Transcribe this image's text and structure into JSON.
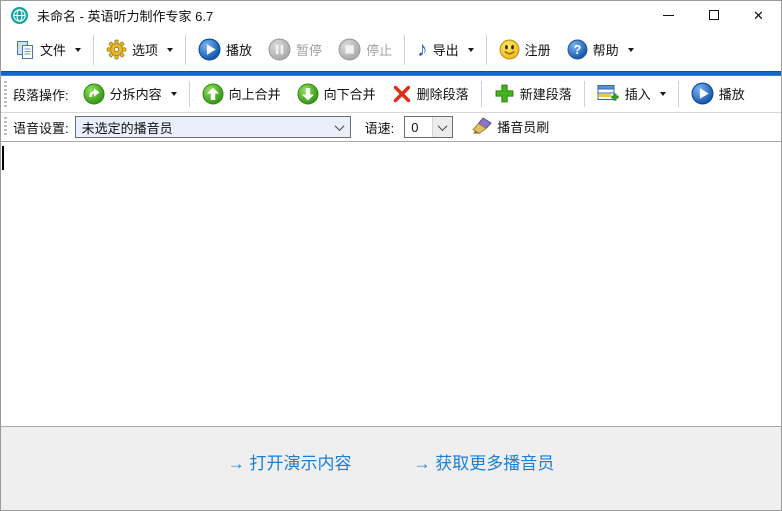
{
  "window": {
    "title": "未命名 - 英语听力制作专家 6.7",
    "controls": {
      "close_glyph": "✕"
    }
  },
  "icons": {
    "app": "teal-globe",
    "file": "copy-pages",
    "options": "gold-gear",
    "play": "blue-play-circle",
    "pause": "gray-pause-circle",
    "stop": "gray-stop-circle",
    "export": "music-note",
    "export_glyph": "♪",
    "register": "smiley-face",
    "help": "question-circle",
    "split": "green-curved-arrow-circle",
    "merge_up": "green-up-arrow-circle",
    "merge_down": "green-down-arrow-circle",
    "delete": "red-x",
    "new_paragraph": "green-plus",
    "insert": "table-with-plus",
    "brush": "paintbrush",
    "dropdown": "down-triangle",
    "combo": "chevron-down"
  },
  "toolbar_main": {
    "file": "文件",
    "options": "选项",
    "play": "播放",
    "pause": "暂停",
    "stop": "停止",
    "export": "导出",
    "register": "注册",
    "help": "帮助"
  },
  "toolbar_paragraph": {
    "label": "段落操作:",
    "split": "分拆内容",
    "merge_up": "向上合并",
    "merge_down": "向下合并",
    "delete": "删除段落",
    "new_paragraph": "新建段落",
    "insert": "插入",
    "play": "播放"
  },
  "toolbar_voice": {
    "label": "语音设置:",
    "announcer_value": "未选定的播音员",
    "speed_label": "语速:",
    "speed_value": "0",
    "brush": "播音员刷"
  },
  "footer": {
    "open_demo": "→ 打开演示内容",
    "more_announcers": "→ 获取更多播音员"
  },
  "colors": {
    "accent_rule": "#1467c4",
    "link_blue": "#1b7fd4",
    "footer_bg": "#efefef",
    "combo_fill": "#e9effb"
  }
}
